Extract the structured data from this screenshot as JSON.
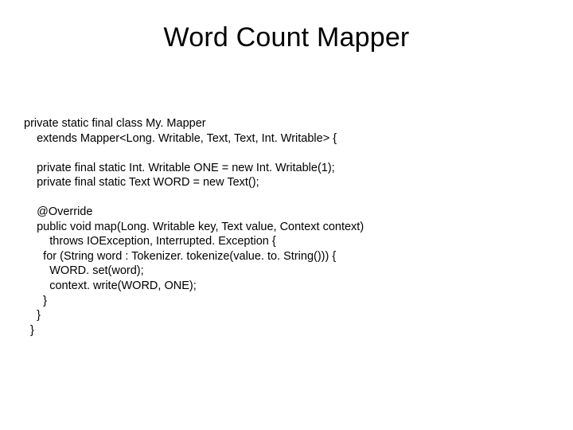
{
  "title": "Word Count Mapper",
  "code": {
    "l01": "private static final class My. Mapper",
    "l02": "    extends Mapper<Long. Writable, Text, Text, Int. Writable> {",
    "l03": "",
    "l04": "    private final static Int. Writable ONE = new Int. Writable(1);",
    "l05": "    private final static Text WORD = new Text();",
    "l06": "",
    "l07": "    @Override",
    "l08": "    public void map(Long. Writable key, Text value, Context context)",
    "l09": "        throws IOException, Interrupted. Exception {",
    "l10": "      for (String word : Tokenizer. tokenize(value. to. String())) {",
    "l11": "        WORD. set(word);",
    "l12": "        context. write(WORD, ONE);",
    "l13": "      }",
    "l14": "    }",
    "l15": "  }"
  }
}
